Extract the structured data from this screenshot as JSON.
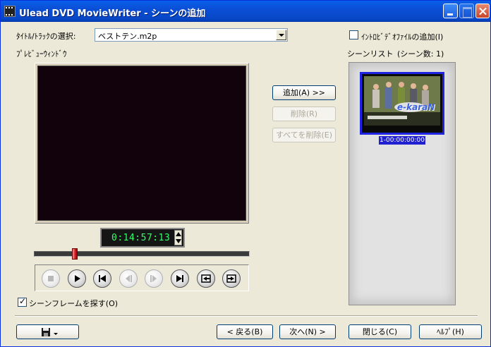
{
  "window": {
    "title": "Ulead DVD MovieWriter - シーンの追加"
  },
  "title_select": {
    "label": "ﾀｲﾄﾙ/ﾄﾗｯｸの選択:",
    "value": "ベストテン.m2p"
  },
  "intro_video": {
    "label": "ｲﾝﾄﾛﾋﾞﾃﾞｵﾌｧｲﾙの追加(I)",
    "checked": false
  },
  "preview": {
    "label": "ﾌﾟﾚﾋﾞｭｰｳｨﾝﾄﾞｳ",
    "timecode": "0:14:57:13",
    "slider_position": 0.18
  },
  "scene_actions": {
    "add": "追加(A) >>",
    "delete": "削除(R)",
    "delete_all": "すべてを削除(E)"
  },
  "scene_list": {
    "label": "シーンリスト",
    "count": "(シーン数: 1)",
    "items": [
      {
        "caption": "1-00:00:00:00",
        "thumb_logo": "e-karaN"
      }
    ]
  },
  "transport": {
    "buttons": [
      "stop",
      "play",
      "prev-scene",
      "prev-frame",
      "next-frame",
      "next-scene",
      "mark-in",
      "mark-out"
    ]
  },
  "scene_frame": {
    "label": "シーンフレームを探す(O)",
    "checked": true
  },
  "footer": {
    "back": "< 戻る(B)",
    "next": "次へ(N) >",
    "close": "閉じる(C)",
    "help": "ﾍﾙﾌﾟ(H)"
  },
  "colors": {
    "titlebar": "#0A55E4",
    "timecode_text": "#33FF66",
    "selection": "#1F24E2",
    "window_bg": "#ECE9D8"
  }
}
